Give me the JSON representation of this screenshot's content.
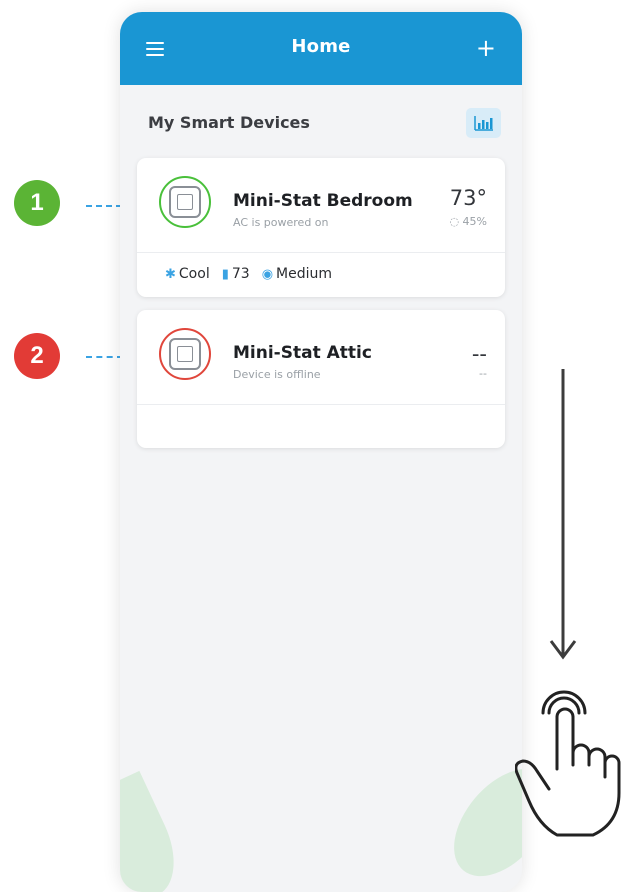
{
  "header": {
    "title": "Home"
  },
  "section": {
    "title": "My Smart Devices"
  },
  "devices": [
    {
      "name": "Mini-Stat Bedroom",
      "status": "AC is powered on",
      "temperature": "73°",
      "humidity": "45%",
      "mode": "Cool",
      "setpoint": "73",
      "fan": "Medium",
      "status_color": "#49c03a"
    },
    {
      "name": "Mini-Stat Attic",
      "status": "Device is offline",
      "temperature": "--",
      "humidity": "--",
      "status_color": "#e0463b"
    }
  ],
  "markers": [
    "1",
    "2"
  ],
  "colors": {
    "accent": "#1a96d3",
    "online": "#5bb435",
    "offline": "#e23b36"
  },
  "icons": [
    "menu-icon",
    "plus-icon",
    "chart-icon",
    "thermostat-icon",
    "snowflake-icon",
    "thermometer-icon",
    "fan-icon",
    "humidity-icon",
    "arrow-down-icon",
    "hand-tap-icon"
  ]
}
